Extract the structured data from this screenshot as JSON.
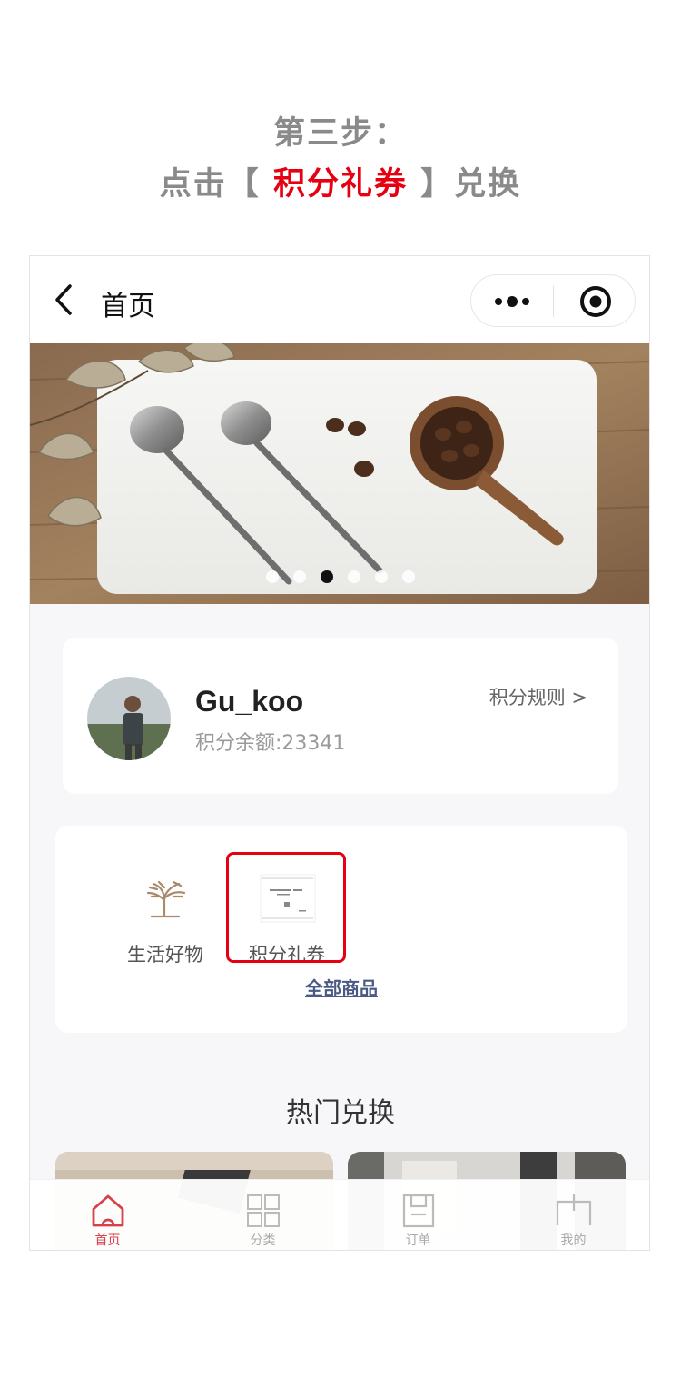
{
  "instruction": {
    "line1": "第三步：",
    "prefix": "点击【 ",
    "highlight": "积分礼券",
    "suffix": " 】兑换",
    "colors": {
      "text": "#8a8a8a",
      "highlight": "#e60012"
    }
  },
  "navbar": {
    "back_icon": "chevron-left-icon",
    "title": "首页",
    "capsule": {
      "more_icon": "more-dots-icon",
      "target_icon": "target-icon"
    }
  },
  "banner": {
    "slide_count": 6,
    "active_index": 2
  },
  "user": {
    "name": "Gu_koo",
    "points_text": "积分余额:23341",
    "rules_link": "积分规则 >"
  },
  "categories": {
    "items": [
      {
        "label": "生活好物",
        "icon": "tree-logo-icon"
      },
      {
        "label": "积分礼券",
        "icon": "voucher-card-icon",
        "highlighted": true
      }
    ],
    "all_link": "全部商品"
  },
  "hot": {
    "title": "热门兑换"
  },
  "tabbar": {
    "items": [
      {
        "label": "首页",
        "icon": "home-icon",
        "active": true
      },
      {
        "label": "分类",
        "icon": "grid-icon",
        "active": false
      },
      {
        "label": "订单",
        "icon": "order-icon",
        "active": false
      },
      {
        "label": "我的",
        "icon": "profile-icon",
        "active": false
      }
    ],
    "active_color": "#d9404a",
    "inactive_color": "#aaaaaa"
  }
}
